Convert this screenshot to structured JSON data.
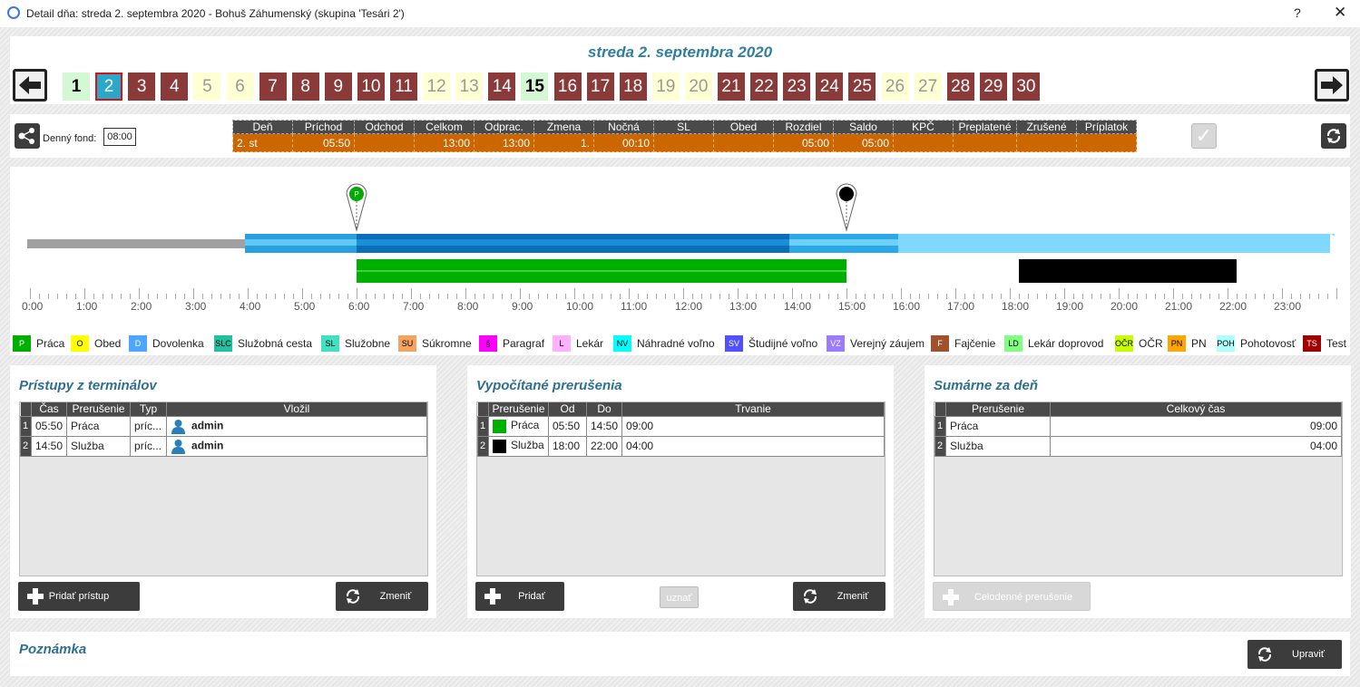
{
  "window": {
    "title": "Detail dňa: streda 2. septembra 2020 -  Bohuš Záhumenský  (skupina 'Tesári 2')",
    "help": "?",
    "close": "✕"
  },
  "header": {
    "date": "streda 2. septembra 2020",
    "days": [
      {
        "label": "1",
        "kind": "green"
      },
      {
        "label": "2",
        "kind": "sel"
      },
      {
        "label": "3",
        "kind": "red"
      },
      {
        "label": "4",
        "kind": "red"
      },
      {
        "label": "5",
        "kind": "cream"
      },
      {
        "label": "6",
        "kind": "cream"
      },
      {
        "label": "7",
        "kind": "red"
      },
      {
        "label": "8",
        "kind": "red"
      },
      {
        "label": "9",
        "kind": "red"
      },
      {
        "label": "10",
        "kind": "red"
      },
      {
        "label": "11",
        "kind": "red"
      },
      {
        "label": "12",
        "kind": "cream"
      },
      {
        "label": "13",
        "kind": "cream"
      },
      {
        "label": "14",
        "kind": "red"
      },
      {
        "label": "15",
        "kind": "green"
      },
      {
        "label": "16",
        "kind": "red"
      },
      {
        "label": "17",
        "kind": "red"
      },
      {
        "label": "18",
        "kind": "red"
      },
      {
        "label": "19",
        "kind": "cream"
      },
      {
        "label": "20",
        "kind": "cream"
      },
      {
        "label": "21",
        "kind": "red"
      },
      {
        "label": "22",
        "kind": "red"
      },
      {
        "label": "23",
        "kind": "red"
      },
      {
        "label": "24",
        "kind": "red"
      },
      {
        "label": "25",
        "kind": "red"
      },
      {
        "label": "26",
        "kind": "cream"
      },
      {
        "label": "27",
        "kind": "cream"
      },
      {
        "label": "28",
        "kind": "red"
      },
      {
        "label": "29",
        "kind": "red"
      },
      {
        "label": "30",
        "kind": "red"
      }
    ]
  },
  "summary": {
    "fund_label": "Denný fond:",
    "fund_value": "08:00",
    "headers": [
      "Deň",
      "Príchod",
      "Odchod",
      "Celkom",
      "Odprac.",
      "Zmena",
      "Nočná",
      "SL",
      "Obed",
      "Rozdiel",
      "Saldo",
      "KPČ",
      "Preplatené",
      "Zrušené",
      "Príplatok"
    ],
    "row": [
      "2. st",
      "05:50",
      "",
      "13:00",
      "13:00",
      "1.",
      "00:10",
      "",
      "",
      "05:00",
      "05:00",
      "",
      "",
      "",
      ""
    ]
  },
  "timeline": {
    "hours": [
      "0:00",
      "1:00",
      "2:00",
      "3:00",
      "4:00",
      "5:00",
      "6:00",
      "7:00",
      "8:00",
      "9:00",
      "10:00",
      "11:00",
      "12:00",
      "13:00",
      "14:00",
      "15:00",
      "16:00",
      "17:00",
      "18:00",
      "19:00",
      "20:00",
      "21:00",
      "22:00",
      "23:00"
    ],
    "markers": [
      {
        "time": "05:50",
        "code": "P",
        "color": "#0a0"
      },
      {
        "time": "14:50",
        "code": "",
        "color": "#000"
      }
    ],
    "segments": [
      {
        "name": "Práca",
        "from": "05:50",
        "to": "14:50",
        "color": "#00b000"
      },
      {
        "name": "Služba",
        "from": "18:00",
        "to": "22:00",
        "color": "#000000"
      }
    ]
  },
  "legend": [
    {
      "code": "P",
      "label": "Práca",
      "color": "#00b000",
      "text": "#fff"
    },
    {
      "code": "O",
      "label": "Obed",
      "color": "#ffff00",
      "text": "#000"
    },
    {
      "code": "D",
      "label": "Dovolenka",
      "color": "#4da6ff",
      "text": "#fff"
    },
    {
      "code": "SLC",
      "label": "Služobná cesta",
      "color": "#20c0a0",
      "text": "#000"
    },
    {
      "code": "SL",
      "label": "Služobne",
      "color": "#40e0c0",
      "text": "#000"
    },
    {
      "code": "SU",
      "label": "Súkromne",
      "color": "#f4a460",
      "text": "#000"
    },
    {
      "code": "§",
      "label": "Paragraf",
      "color": "#ff00ff",
      "text": "#000"
    },
    {
      "code": "L",
      "label": "Lekár",
      "color": "#ffb0ff",
      "text": "#000"
    },
    {
      "code": "NV",
      "label": "Náhradné voľno",
      "color": "#00ffff",
      "text": "#000"
    },
    {
      "code": "SV",
      "label": "Študijné voľno",
      "color": "#5050ff",
      "text": "#fff"
    },
    {
      "code": "VZ",
      "label": "Verejný záujem",
      "color": "#9b7bff",
      "text": "#fff"
    },
    {
      "code": "F",
      "label": "Fajčenie",
      "color": "#a0522d",
      "text": "#fff"
    },
    {
      "code": "LD",
      "label": "Lekár doprovod",
      "color": "#80ff80",
      "text": "#000"
    },
    {
      "code": "OČR",
      "label": "OČR",
      "color": "#c8ff00",
      "text": "#000"
    },
    {
      "code": "PN",
      "label": "PN",
      "color": "#ffa500",
      "text": "#000"
    },
    {
      "code": "POH",
      "label": "Pohotovosť",
      "color": "#b0ffff",
      "text": "#000"
    },
    {
      "code": "TS",
      "label": "Test",
      "color": "#a00000",
      "text": "#fff"
    }
  ],
  "access": {
    "title": "Prístupy z terminálov",
    "headers": [
      "Čas",
      "Prerušenie",
      "Typ",
      "Vložil"
    ],
    "rows": [
      {
        "n": "1",
        "time": "05:50",
        "type": "Práca",
        "kind": "príc...",
        "by": "admin"
      },
      {
        "n": "2",
        "time": "14:50",
        "type": "Služba",
        "kind": "príc...",
        "by": "admin"
      }
    ],
    "add_btn": "Pridať prístup",
    "change_btn": "Zmeniť"
  },
  "computed": {
    "title": "Vypočítané prerušenia",
    "headers": [
      "Prerušenie",
      "Od",
      "Do",
      "Trvanie"
    ],
    "rows": [
      {
        "n": "1",
        "name": "Práca",
        "color": "#00b000",
        "from": "05:50",
        "to": "14:50",
        "dur": "09:00"
      },
      {
        "n": "2",
        "name": "Služba",
        "color": "#000000",
        "from": "18:00",
        "to": "22:00",
        "dur": "04:00"
      }
    ],
    "add_btn": "Pridať",
    "accept_btn": "uznať",
    "change_btn": "Zmeniť"
  },
  "daily": {
    "title": "Sumárne za deň",
    "headers": [
      "Prerušenie",
      "Celkový čas"
    ],
    "rows": [
      {
        "n": "1",
        "name": "Práca",
        "total": "09:00"
      },
      {
        "n": "2",
        "name": "Služba",
        "total": "04:00"
      }
    ],
    "whole_day_btn": "Celodenné prerušenie"
  },
  "note": {
    "title": "Poznámka",
    "edit_btn": "Upraviť"
  }
}
